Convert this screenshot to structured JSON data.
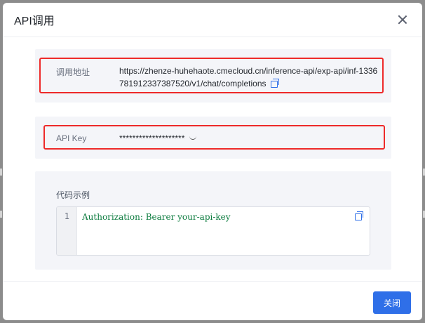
{
  "dialog": {
    "title": "API调用",
    "close_icon": "close-icon"
  },
  "endpoint": {
    "label": "调用地址",
    "url": "https://zhenze-huhehaote.cmecloud.cn/inference-api/exp-api/inf-1336781912337387520/v1/chat/completions",
    "copy_icon": "copy-icon"
  },
  "api_key": {
    "label": "API Key",
    "masked_value": "********************",
    "toggle_icon": "eye-closed-icon"
  },
  "code_example": {
    "label": "代码示例",
    "lines": [
      {
        "number": "1",
        "text": "Authorization: Bearer your-api-key"
      }
    ],
    "copy_icon": "copy-icon"
  },
  "footer": {
    "close_label": "关闭"
  },
  "colors": {
    "primary": "#2f6fe8",
    "highlight": "#ee2a2a",
    "code_text": "#0b7b3e",
    "section_bg": "#f4f5f9"
  }
}
